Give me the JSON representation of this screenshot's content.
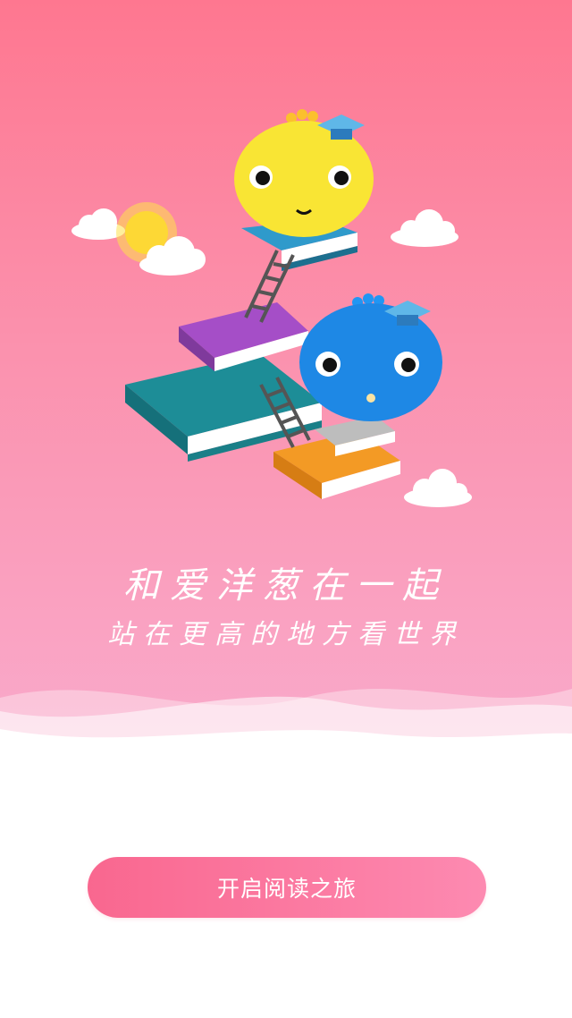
{
  "hero": {
    "slogan_line1": "和爱洋葱在一起",
    "slogan_line2": "站在更高的地方看世界",
    "background_top": "#fe7790",
    "background_bottom": "#f9aacb"
  },
  "illustration": {
    "icons": [
      "cloud-icon",
      "sun-icon",
      "book-stack-icon",
      "ladder-icon",
      "yellow-onion-mascot",
      "blue-onion-mascot",
      "graduation-cap-icon"
    ]
  },
  "actions": {
    "start_label": "开启阅读之旅",
    "start_color": "#f9678f"
  }
}
